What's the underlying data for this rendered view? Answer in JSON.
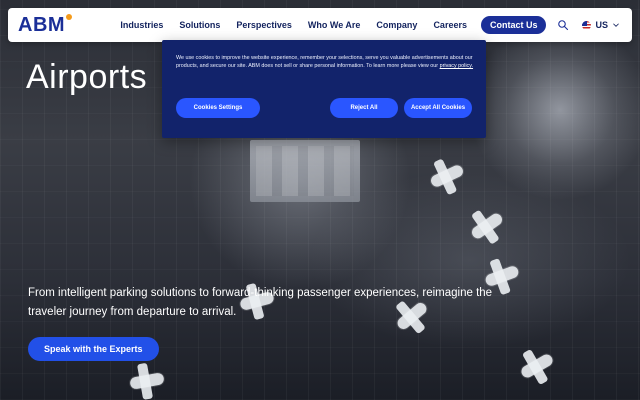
{
  "brand": {
    "logo_text": "ABM",
    "logo_color": "#1b2f98",
    "accent_dot_color": "#f59b1b"
  },
  "navbar": {
    "items": [
      {
        "label": "Industries"
      },
      {
        "label": "Solutions"
      },
      {
        "label": "Perspectives"
      },
      {
        "label": "Who We Are"
      },
      {
        "label": "Company"
      },
      {
        "label": "Careers"
      }
    ],
    "contact_label": "Contact Us",
    "search_icon": "search-icon",
    "language": {
      "label": "US",
      "icon": "us-flag-icon",
      "chevron_icon": "chevron-down-icon"
    }
  },
  "hero": {
    "title": "Airports",
    "subtitle": "From intelligent parking solutions to forward-thinking passenger experiences, reimagine the traveler journey from departure to arrival.",
    "cta_label": "Speak with the Experts"
  },
  "cookie_banner": {
    "text_before_link": "We use cookies to improve the website experience, remember your selections, serve you valuable advertisements about our products, and secure our site. ABM does not sell or share personal information. To learn more please view our",
    "privacy_link_label": "privacy policy.",
    "settings_label": "Cookies Settings",
    "reject_label": "Reject All",
    "accept_label": "Accept All Cookies"
  },
  "colors": {
    "primary_blue": "#1b2f98",
    "cta_blue": "#2250e8",
    "cookie_bg": "#12236b",
    "cookie_button": "#2a56ff"
  }
}
